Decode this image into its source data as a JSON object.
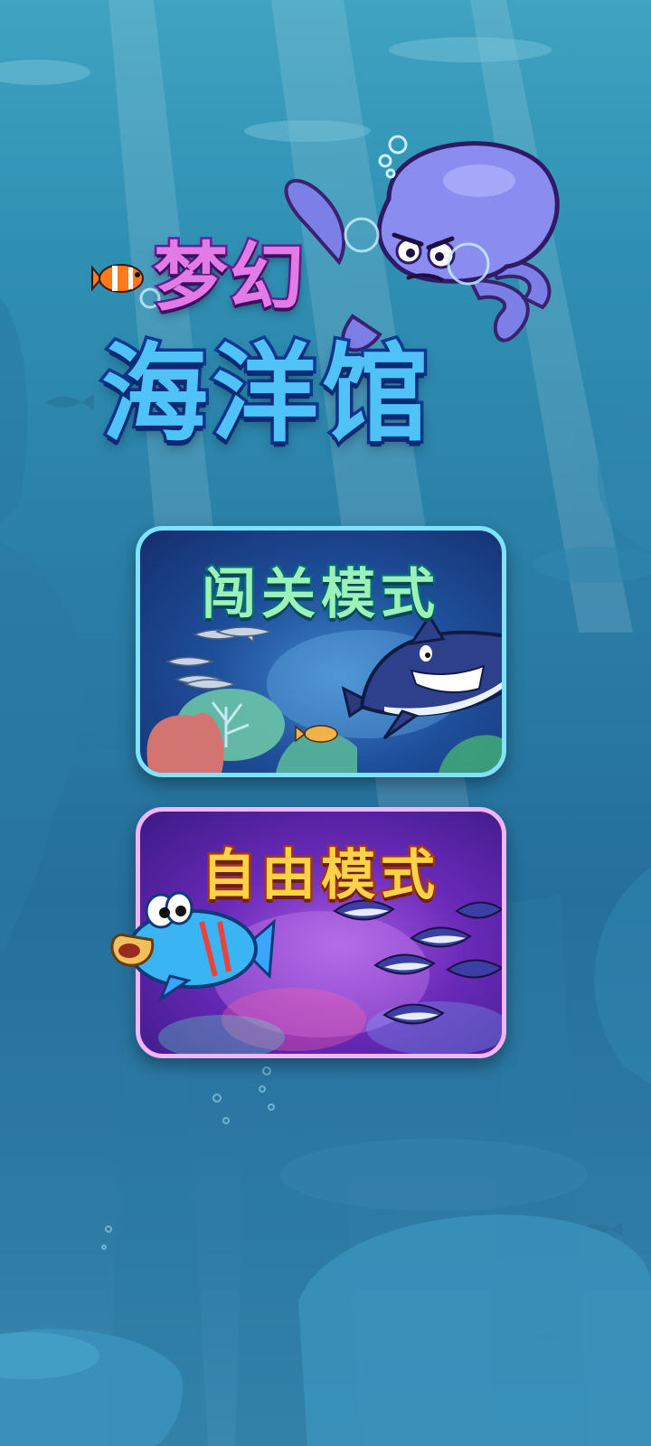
{
  "screen": "main-menu",
  "title": {
    "line1": "梦幻",
    "line2": "海洋馆"
  },
  "modes": {
    "level": {
      "label": "闯关模式"
    },
    "free": {
      "label": "自由模式"
    }
  },
  "colors": {
    "ocean_top": "#3fa3c1",
    "ocean_bottom": "#256f9c",
    "title_pink": "#e37be6",
    "title_blue": "#4fc2f7",
    "level_border": "#7fe3ff",
    "free_border": "#f2b4ff",
    "level_text": "#9af2b8",
    "free_text": "#ffd24a"
  }
}
